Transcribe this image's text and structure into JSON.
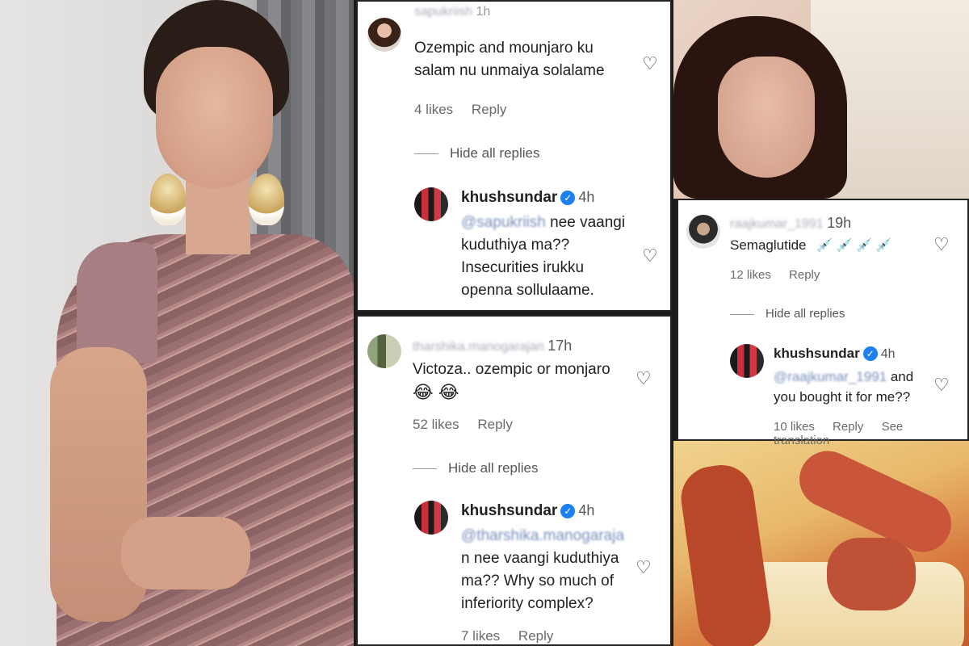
{
  "card_a": {
    "comment_user": "sapukriish",
    "comment_time": "1h",
    "comment_text_1": "Ozempic and mounjaro ku",
    "comment_text_2": "salam nu unmaiya solalame",
    "likes": "4 likes",
    "reply_label": "Reply",
    "hide_replies": "Hide all replies",
    "reply_user": "khushsundar",
    "reply_time": "4h",
    "reply_mention": "@sapukriish",
    "reply_text_1": " nee vaangi",
    "reply_text_2": "kuduthiya ma??",
    "reply_text_3": "Insecurities irukku",
    "reply_text_4": "openna sollulaame."
  },
  "card_b": {
    "comment_user": "tharshika.manogarajan",
    "comment_time": "17h",
    "comment_text_1": "Victoza.. ozempic or monjaro",
    "emojis": "😂 😂",
    "likes": "52 likes",
    "reply_label": "Reply",
    "hide_replies": "Hide all replies",
    "reply_user": "khushsundar",
    "reply_time": "4h",
    "reply_mention": "@tharshika.manogaraja",
    "reply_text_1": "n nee vaangi kuduthiya",
    "reply_text_2": "ma?? Why so much of",
    "reply_text_3": "inferiority complex?",
    "reply_likes": "7 likes",
    "reply_reply_label": "Reply"
  },
  "card_c": {
    "comment_user": "raajkumar_1991",
    "comment_time": "19h",
    "comment_text_1": "Semaglutide",
    "syringes": "💉 💉 💉 💉",
    "likes": "12 likes",
    "reply_label": "Reply",
    "hide_replies": "Hide all replies",
    "reply_user": "khushsundar",
    "reply_time": "4h",
    "reply_mention": "@raajkumar_1991",
    "reply_text_1": " and",
    "reply_text_2": "you bought it for me??",
    "reply_likes": "10 likes",
    "reply_reply_label": "Reply",
    "see_translation": "See translation"
  },
  "icons": {
    "heart": "♡",
    "verified": "✓"
  },
  "colors": {
    "verified_blue": "#1d7ff0",
    "mention_blue": "#7a8fbd"
  }
}
